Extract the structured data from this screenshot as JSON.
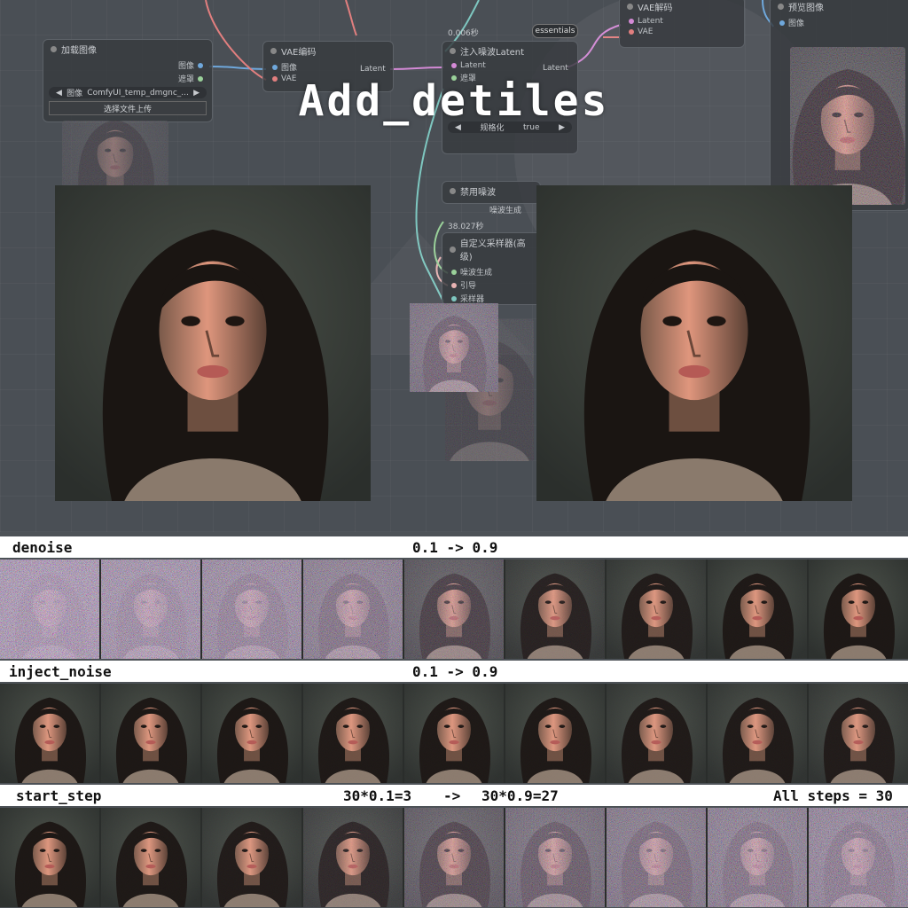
{
  "title": "Add_detiles",
  "background_graph": {
    "load_image_node": {
      "title": "加载图像",
      "outputs": [
        "图像",
        "遮罩"
      ],
      "file_value": "ComfyUI_temp_dmgnc_...",
      "file_label": "图像",
      "upload_button": "选择文件上传"
    },
    "vae_encode_node": {
      "title": "VAE编码",
      "inputs": [
        "图像",
        "VAE"
      ]
    },
    "inject_noise_node": {
      "title": "注入噪波Latent",
      "inputs": [
        "Latent",
        "遮罩"
      ],
      "output": "Latent",
      "widget_label": "规格化",
      "widget_value": "true",
      "value_hidden": "0.00"
    },
    "vae_decode_node": {
      "title": "VAE解码",
      "inputs": [
        "Latent",
        "VAE"
      ]
    },
    "preview_node": {
      "title": "预览图像",
      "input": "图像"
    },
    "disable_noise_node": {
      "title": "禁用噪波"
    },
    "sampler_node": {
      "title": "自定义采样器(高级)",
      "inputs": [
        "噪波生成",
        "引导",
        "采样器"
      ],
      "top_label": "噪波生成"
    },
    "timings": [
      "0.006秒",
      "38.027秒"
    ],
    "essentials_badge": "essentials",
    "latent_labels": [
      "Latent",
      "Latent"
    ]
  },
  "strips": [
    {
      "label": "denoise",
      "range_from": "0.1",
      "arrow": "->",
      "range_to": "0.9"
    },
    {
      "label": "inject_noise",
      "range_text": "0.1 -> 0.9"
    },
    {
      "label": "start_step",
      "from_prefix": "30*",
      "from_factor": "0.1",
      "from_suffix": "=3",
      "arrow": "->",
      "to_prefix": "30*",
      "to_factor": "0.9",
      "to_suffix": "=27",
      "note": "All steps = 30"
    }
  ],
  "strip_noise_levels": {
    "denoise": [
      0.9,
      0.85,
      0.8,
      0.7,
      0.35,
      0.1,
      0.05,
      0.03,
      0.02
    ],
    "inject_noise": [
      0.02,
      0.02,
      0.02,
      0.03,
      0.03,
      0.03,
      0.04,
      0.04,
      0.05
    ],
    "start_step": [
      0.02,
      0.03,
      0.05,
      0.15,
      0.4,
      0.55,
      0.65,
      0.7,
      0.75
    ]
  },
  "colors": {
    "accent_red": "#e52b2b",
    "strip_bar": "#ffffff",
    "canvas": "#4d5257"
  }
}
